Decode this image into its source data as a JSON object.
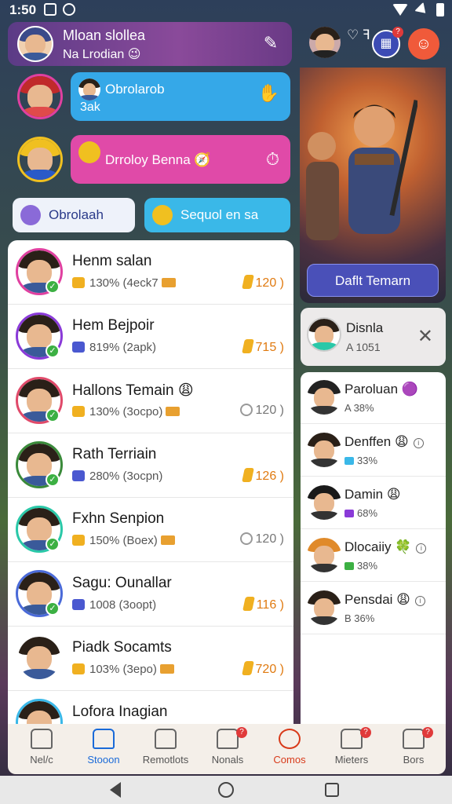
{
  "status": {
    "time": "1:50"
  },
  "header": {
    "title": "Mloan slollea",
    "subtitle": "Na Lrodian 😉"
  },
  "chats": [
    {
      "title": "Obrolarob",
      "text": "3ak",
      "color": "#35a8e8",
      "av_color": "#e03a3a"
    },
    {
      "title": "Drroloy Benna 🧭",
      "text": "",
      "color": "#e04aa8",
      "av_color": "#f0c020"
    }
  ],
  "pills": [
    {
      "label": "Obrolaah",
      "bg": "#eef2fa",
      "color": "#2a3a8a"
    },
    {
      "label": "Sequol en sa",
      "bg": "#3ab8e8",
      "color": "#fff"
    }
  ],
  "leaderboard": [
    {
      "name": "Henm salan",
      "stat": "130% (4eck7",
      "score": "120 )",
      "gray": false,
      "ring": "#e040a0",
      "stat_icon": "#f0b020"
    },
    {
      "name": "Hem Bejpoir",
      "stat": "819% (2apk)",
      "score": "715 )",
      "gray": false,
      "ring": "#8a3ad8",
      "stat_icon": "#4a58d0"
    },
    {
      "name": "Hallons Temain 😩",
      "stat": "130% (3ocpo)",
      "score": "120 )",
      "gray": true,
      "ring": "#e04a6a",
      "stat_icon": "#f0b020"
    },
    {
      "name": "Rath Terriain",
      "stat": "280% (3ocpn)",
      "score": "126 )",
      "gray": false,
      "ring": "#3a8a3a",
      "stat_icon": "#4a58d0"
    },
    {
      "name": "Fxhn Senpion",
      "stat": "150% (Boex)",
      "score": "120 )",
      "gray": true,
      "ring": "#2ac8a8",
      "stat_icon": "#f0b020"
    },
    {
      "name": "Sagu: Ounallar",
      "stat": "1008 (3oopt)",
      "score": "116 )",
      "gray": false,
      "ring": "#4a6ad8",
      "stat_icon": "#4a58d0"
    },
    {
      "name": "Piadk Socamts",
      "stat": "103% (3epo)",
      "score": "720 )",
      "gray": false,
      "ring": "#ffffff",
      "stat_icon": "#f0b020"
    },
    {
      "name": "Lofora Inagian",
      "stat": "",
      "score": "",
      "gray": false,
      "ring": "#3ab8e8",
      "stat_icon": "#4a58d0"
    }
  ],
  "right_top": {
    "mid": "♡ ꟻ",
    "btn1": "▦",
    "badge": "?",
    "btn2": "☺"
  },
  "hero": {
    "button": "Daflt Temarn"
  },
  "notification": {
    "title": "Disnla",
    "sub": "A 1051",
    "close": "✕"
  },
  "friends": [
    {
      "name": "Paroluan 🟣",
      "stat": "A 38%",
      "icon": "",
      "info": false
    },
    {
      "name": "Denffen 😩",
      "stat": "33%",
      "icon": "#3ab8e8",
      "info": true
    },
    {
      "name": "Damin 😩",
      "stat": "68%",
      "icon": "#8a3ad8",
      "info": false
    },
    {
      "name": "Dlocaiiy 🍀",
      "stat": "38%",
      "icon": "#3cb043",
      "info": true
    },
    {
      "name": "Pensdai 😩",
      "stat": "B 36%",
      "icon": "",
      "info": true
    }
  ],
  "nav": [
    {
      "label": "Nel/c",
      "state": "normal",
      "badge": ""
    },
    {
      "label": "Stooon",
      "state": "active",
      "badge": ""
    },
    {
      "label": "Remotlots",
      "state": "normal",
      "badge": ""
    },
    {
      "label": "Nonals",
      "state": "normal",
      "badge": "?"
    },
    {
      "label": "Comos",
      "state": "alert",
      "badge": ""
    },
    {
      "label": "Mieters",
      "state": "normal",
      "badge": "?"
    },
    {
      "label": "Bors",
      "state": "normal",
      "badge": "?"
    }
  ],
  "icons": {
    "status": [
      "screen-record-icon",
      "notification-icon",
      "wifi-icon",
      "signal-icon",
      "battery-icon"
    ],
    "header_action": "edit-icon",
    "nav": [
      "home-icon",
      "shop-icon",
      "remote-icon",
      "notes-icon",
      "games-icon",
      "meters-icon",
      "box-icon"
    ]
  }
}
